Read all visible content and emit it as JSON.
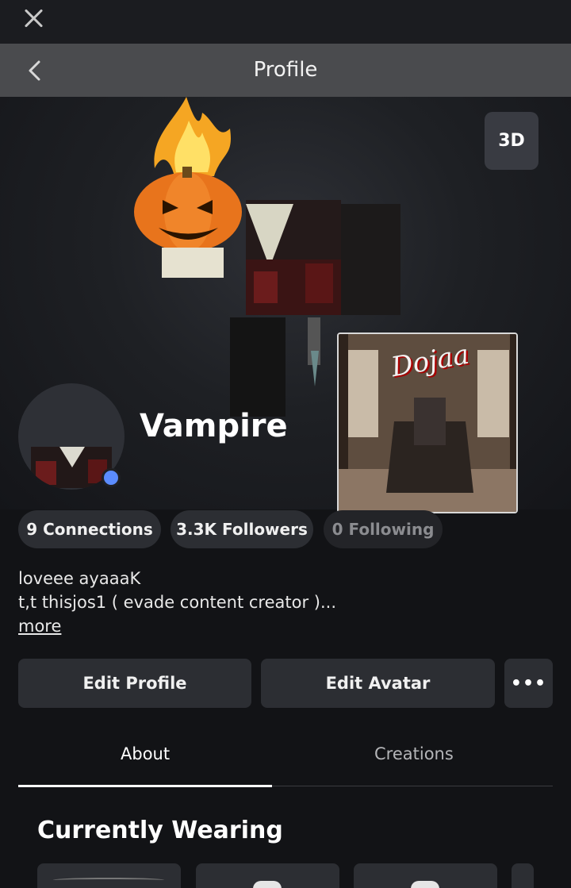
{
  "header": {
    "title": "Profile"
  },
  "hero": {
    "view_3d_label": "3D",
    "showcase_text": "Dojaa"
  },
  "profile": {
    "username": "Vampire",
    "online_status_color": "#5b8cff"
  },
  "stats": {
    "connections": "9 Connections",
    "followers": "3.3K Followers",
    "following": "0 Following"
  },
  "bio": {
    "line1": "loveee ayaaaK",
    "line2": "t,t thisjos1 ( evade content creator )...",
    "more_label": "more"
  },
  "actions": {
    "edit_profile": "Edit Profile",
    "edit_avatar": "Edit Avatar",
    "more_options": "•••"
  },
  "tabs": [
    {
      "label": "About",
      "active": true
    },
    {
      "label": "Creations",
      "active": false
    }
  ],
  "wearing": {
    "title": "Currently Wearing"
  },
  "icons": [
    "close-icon",
    "back-arrow-icon",
    "more-dots-icon"
  ]
}
